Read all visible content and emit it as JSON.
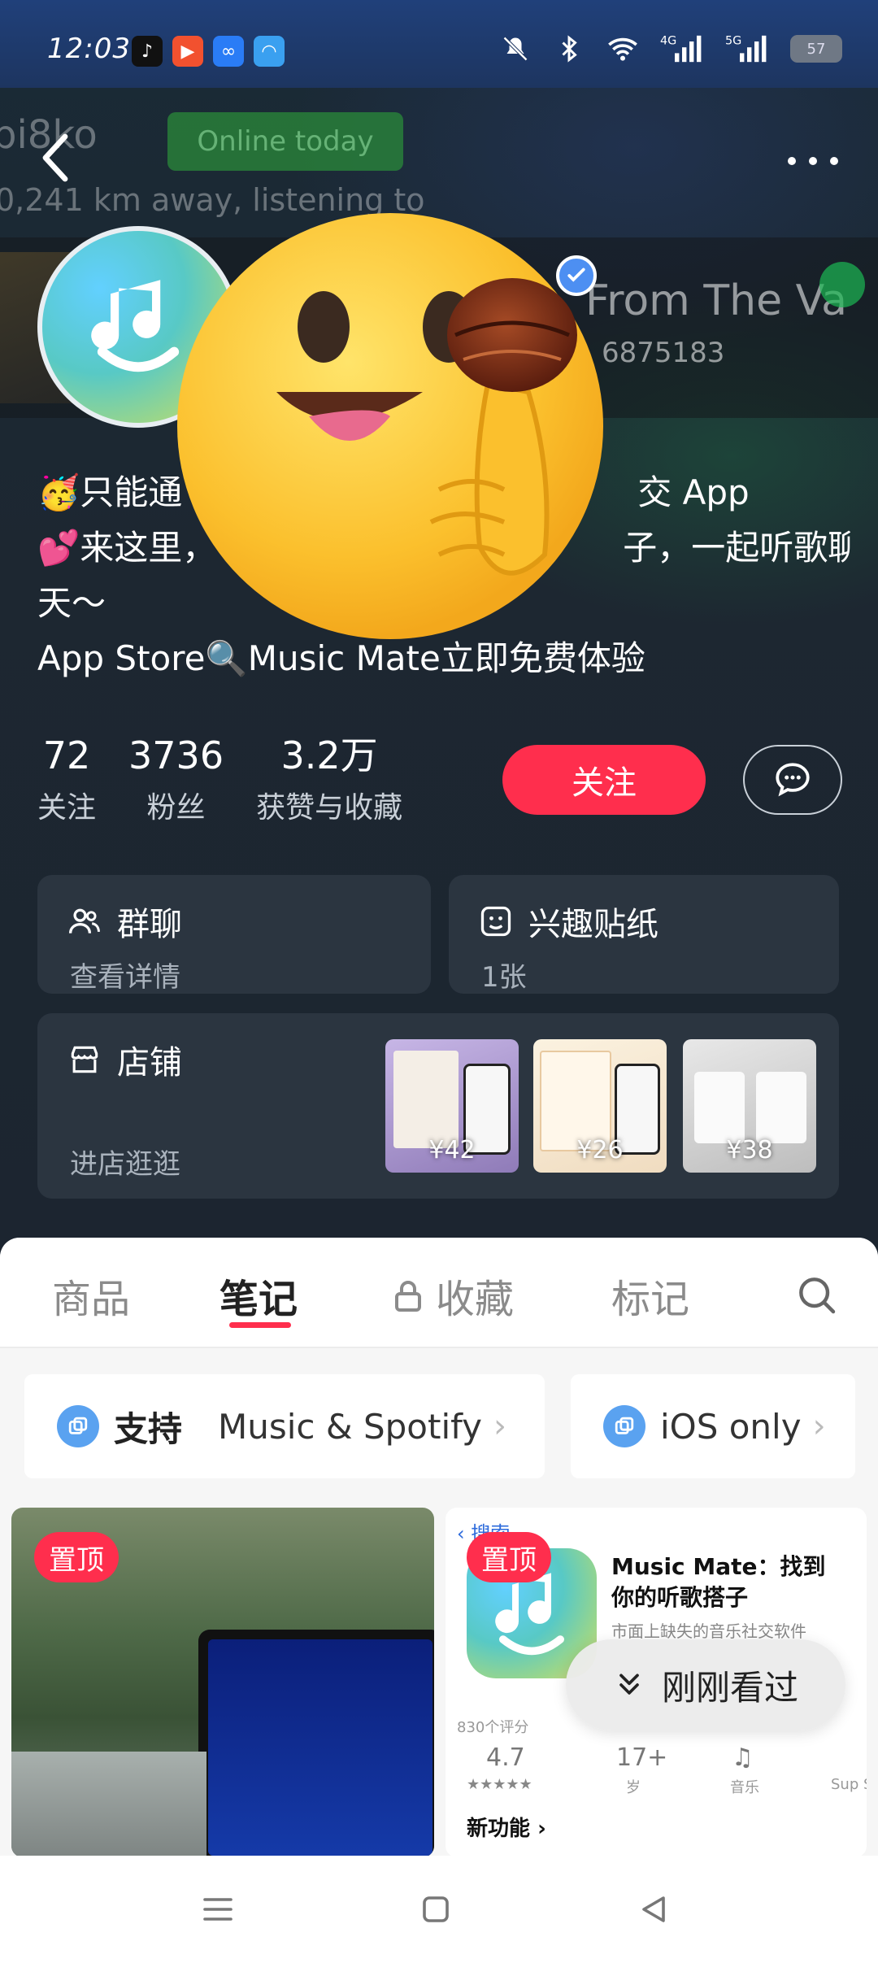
{
  "status_bar": {
    "time": "12:03",
    "network_a": "4G",
    "network_b": "5G",
    "battery": "57"
  },
  "header": {
    "ghost_name": "pi8ko",
    "online_label": "Online today",
    "ghost_distance": "0,241 km away,  listening to"
  },
  "music": {
    "title": "From The Va",
    "id": "6875183"
  },
  "bio": {
    "line1": "🥳只能通",
    "line1_tail": "交 App",
    "line2": "💕来这里，",
    "line2_tail": "子，一起听歌聊",
    "line3": "天～",
    "line4_a": "App Store",
    "line4_b": "Music Mate立即免费体验"
  },
  "stats": [
    {
      "num": "72",
      "label": "关注"
    },
    {
      "num": "3736",
      "label": "粉丝"
    },
    {
      "num": "3.2万",
      "label": "获赞与收藏"
    }
  ],
  "actions": {
    "follow": "关注"
  },
  "cards": {
    "group_title": "群聊",
    "group_sub": "查看详情",
    "sticker_title": "兴趣贴纸",
    "sticker_sub": "1张",
    "shop_title": "店铺",
    "shop_sub": "进店逛逛",
    "shop_items": [
      {
        "price": "¥42"
      },
      {
        "price": "¥26"
      },
      {
        "price": "¥38"
      }
    ]
  },
  "tabs": {
    "goods": "商品",
    "notes": "笔记",
    "collect": "收藏",
    "marks": "标记"
  },
  "chips": {
    "support": "支持",
    "support_value": "Music & Spotify",
    "ios": "iOS only"
  },
  "notes": {
    "pin": "置顶",
    "pin2": "置顶",
    "app_title": "Music Mate：找到你的听歌搭子",
    "app_sub": "市面上缺失的音乐社交软件",
    "back_label": "搜索",
    "rating_count": "830个评分",
    "rating": "4.7",
    "age": "17+",
    "age_unit": "岁",
    "category": "音乐",
    "dev": "Sup Sp",
    "new_features": "新功能"
  },
  "recent": {
    "label": "刚刚看过"
  }
}
